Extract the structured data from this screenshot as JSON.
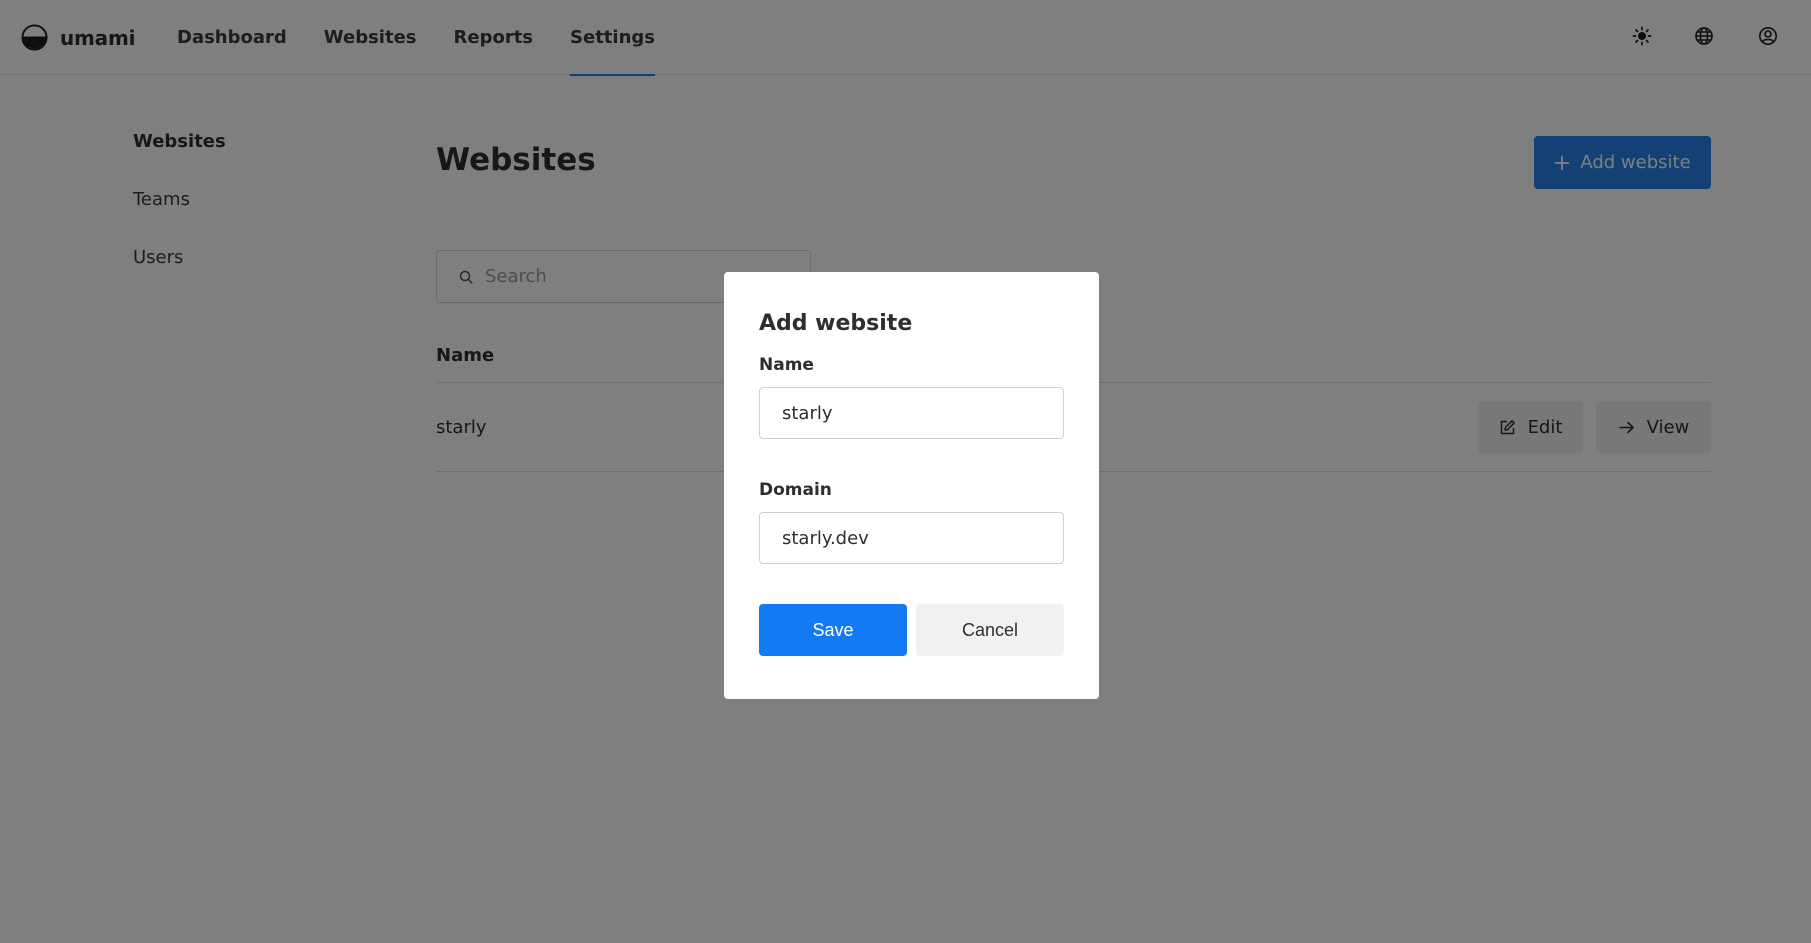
{
  "app": {
    "name": "umami"
  },
  "nav": {
    "items": [
      {
        "label": "Dashboard",
        "active": false
      },
      {
        "label": "Websites",
        "active": false
      },
      {
        "label": "Reports",
        "active": false
      },
      {
        "label": "Settings",
        "active": true
      }
    ]
  },
  "header_icons": [
    "sun-icon",
    "globe-icon",
    "user-profile-icon"
  ],
  "sidebar": {
    "items": [
      {
        "label": "Websites",
        "active": true
      },
      {
        "label": "Teams",
        "active": false
      },
      {
        "label": "Users",
        "active": false
      }
    ]
  },
  "main": {
    "title": "Websites",
    "add_button_label": "Add website",
    "search_placeholder": "Search",
    "table": {
      "columns": [
        "Name"
      ],
      "rows": [
        {
          "name": "starly",
          "actions": [
            "Edit",
            "View"
          ]
        }
      ]
    }
  },
  "modal": {
    "title": "Add website",
    "name_label": "Name",
    "name_value": "starly",
    "domain_label": "Domain",
    "domain_value": "starly.dev",
    "save_label": "Save",
    "cancel_label": "Cancel"
  },
  "colors": {
    "accent": "#2680eb",
    "save_button": "#147af3",
    "overlay": "rgba(0,0,0,0.5)"
  }
}
